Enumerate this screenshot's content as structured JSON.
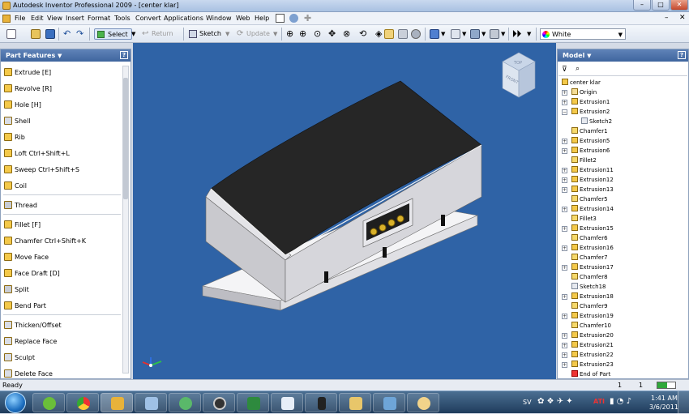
{
  "window": {
    "title": "Autodesk Inventor Professional 2009 - [center klar]",
    "controls": [
      "minimize-icon",
      "maximize-icon",
      "close-icon"
    ]
  },
  "menu": [
    "File",
    "Edit",
    "View",
    "Insert",
    "Format",
    "Tools",
    "Convert",
    "Applications",
    "Window",
    "Web",
    "Help"
  ],
  "toolbar": {
    "select_label": "Select",
    "return_label": "Return",
    "sketch_label": "Sketch",
    "update_label": "Update",
    "color_value": "White"
  },
  "left_panel": {
    "title": "Part Features",
    "items": [
      {
        "label": "Extrude   [E]"
      },
      {
        "label": "Revolve   [R]"
      },
      {
        "label": "Hole   [H]"
      },
      {
        "label": "Shell"
      },
      {
        "label": "Rib"
      },
      {
        "label": "Loft   Ctrl+Shift+L"
      },
      {
        "label": "Sweep   Ctrl+Shift+S"
      },
      {
        "label": "Coil"
      },
      {
        "label": "Thread"
      },
      {
        "label": "Fillet   [F]"
      },
      {
        "label": "Chamfer   Ctrl+Shift+K"
      },
      {
        "label": "Move Face"
      },
      {
        "label": "Face Draft   [D]"
      },
      {
        "label": "Split"
      },
      {
        "label": "Bend Part"
      },
      {
        "label": "Thicken/Offset"
      },
      {
        "label": "Replace Face"
      },
      {
        "label": "Sculpt"
      },
      {
        "label": "Delete Face"
      }
    ]
  },
  "right_panel": {
    "title": "Model",
    "root": "center klar",
    "nodes": [
      {
        "label": "Origin",
        "type": "folder"
      },
      {
        "label": "Extrusion1",
        "type": "feature"
      },
      {
        "label": "Extrusion2",
        "type": "feature"
      },
      {
        "label": "Sketch2",
        "type": "sketch"
      },
      {
        "label": "Chamfer1",
        "type": "chamfer"
      },
      {
        "label": "Extrusion5",
        "type": "feature"
      },
      {
        "label": "Extrusion6",
        "type": "feature"
      },
      {
        "label": "Fillet2",
        "type": "chamfer"
      },
      {
        "label": "Extrusion11",
        "type": "feature"
      },
      {
        "label": "Extrusion12",
        "type": "feature"
      },
      {
        "label": "Extrusion13",
        "type": "feature"
      },
      {
        "label": "Chamfer5",
        "type": "chamfer"
      },
      {
        "label": "Extrusion14",
        "type": "feature"
      },
      {
        "label": "Fillet3",
        "type": "chamfer"
      },
      {
        "label": "Extrusion15",
        "type": "feature"
      },
      {
        "label": "Chamfer6",
        "type": "chamfer"
      },
      {
        "label": "Extrusion16",
        "type": "feature"
      },
      {
        "label": "Chamfer7",
        "type": "chamfer"
      },
      {
        "label": "Extrusion17",
        "type": "feature"
      },
      {
        "label": "Chamfer8",
        "type": "chamfer"
      },
      {
        "label": "Sketch18",
        "type": "sketch"
      },
      {
        "label": "Extrusion18",
        "type": "feature"
      },
      {
        "label": "Chamfer9",
        "type": "chamfer"
      },
      {
        "label": "Extrusion19",
        "type": "feature"
      },
      {
        "label": "Chamfer10",
        "type": "chamfer"
      },
      {
        "label": "Extrusion20",
        "type": "feature"
      },
      {
        "label": "Extrusion21",
        "type": "feature"
      },
      {
        "label": "Extrusion22",
        "type": "feature"
      },
      {
        "label": "Extrusion23",
        "type": "feature"
      },
      {
        "label": "End of Part",
        "type": "end"
      }
    ]
  },
  "viewcube": {
    "front": "FRONT",
    "top": "TOP"
  },
  "status": {
    "text": "Ready",
    "count1": "1",
    "count2": "1"
  },
  "taskbar": {
    "language": "SV",
    "time": "1:41 AM",
    "date": "3/6/2011"
  },
  "colors": {
    "viewport": "#2f63a6",
    "panel_header": "#3f659e",
    "roof": "#262626",
    "body": "#d8d8dc"
  }
}
